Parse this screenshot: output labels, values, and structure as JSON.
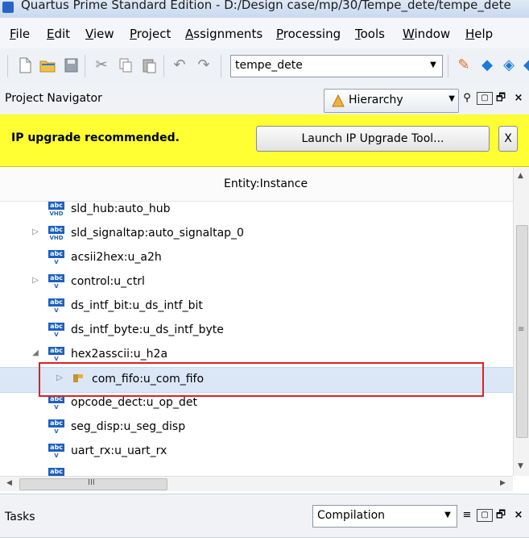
{
  "window": {
    "title": "Quartus Prime Standard Edition - D:/Design case/mp/30/Tempe_dete/tempe_dete"
  },
  "menu": {
    "items": [
      {
        "u": "F",
        "rest": "ile"
      },
      {
        "u": "E",
        "rest": "dit"
      },
      {
        "u": "V",
        "rest": "iew"
      },
      {
        "u": "P",
        "rest": "roject"
      },
      {
        "u": "A",
        "rest": "ssignments"
      },
      {
        "u": "P",
        "rest": "rocessing"
      },
      {
        "u": "T",
        "rest": "ools"
      },
      {
        "u": "W",
        "rest": "indow"
      },
      {
        "u": "H",
        "rest": "elp"
      }
    ]
  },
  "toolbar": {
    "icons": [
      "new-file-icon",
      "open-folder-icon",
      "save-icon",
      "cut-icon",
      "copy-icon",
      "paste-icon",
      "undo-icon",
      "redo-icon"
    ],
    "project_combo": "tempe_dete",
    "right_icons": [
      "pen-icon",
      "compile-diamond-icon",
      "analysis-diamond-icon"
    ]
  },
  "navigator": {
    "title": "Project Navigator",
    "view": "Hierarchy"
  },
  "banner": {
    "message": "IP upgrade recommended.",
    "button": "Launch IP Upgrade Tool...",
    "close": "X"
  },
  "tree": {
    "column": "Entity:Instance",
    "rows": [
      {
        "label": "sld_hub:auto_hub",
        "expander": "",
        "type": "vhd"
      },
      {
        "label": "sld_signaltap:auto_signaltap_0",
        "expander": "▷",
        "type": "vhd"
      },
      {
        "label": "acsii2hex:u_a2h",
        "expander": "",
        "type": "v"
      },
      {
        "label": "control:u_ctrl",
        "expander": "▷",
        "type": "v"
      },
      {
        "label": "ds_intf_bit:u_ds_intf_bit",
        "expander": "",
        "type": "v"
      },
      {
        "label": "ds_intf_byte:u_ds_intf_byte",
        "expander": "",
        "type": "v"
      },
      {
        "label": "hex2asscii:u_h2a",
        "expander": "◢",
        "type": "v"
      },
      {
        "label": "com_fifo:u_com_fifo",
        "expander": "▷",
        "type": "ip",
        "selected": true
      },
      {
        "label": "opcode_dect:u_op_det",
        "expander": "",
        "type": "v"
      },
      {
        "label": "seg_disp:u_seg_disp",
        "expander": "",
        "type": "v"
      },
      {
        "label": "uart_rx:u_uart_rx",
        "expander": "",
        "type": "v"
      },
      {
        "label": "",
        "expander": "",
        "type": "v"
      }
    ]
  },
  "hscroll": {
    "grip": "III"
  },
  "tasks": {
    "title": "Tasks",
    "flow": "Compilation"
  }
}
